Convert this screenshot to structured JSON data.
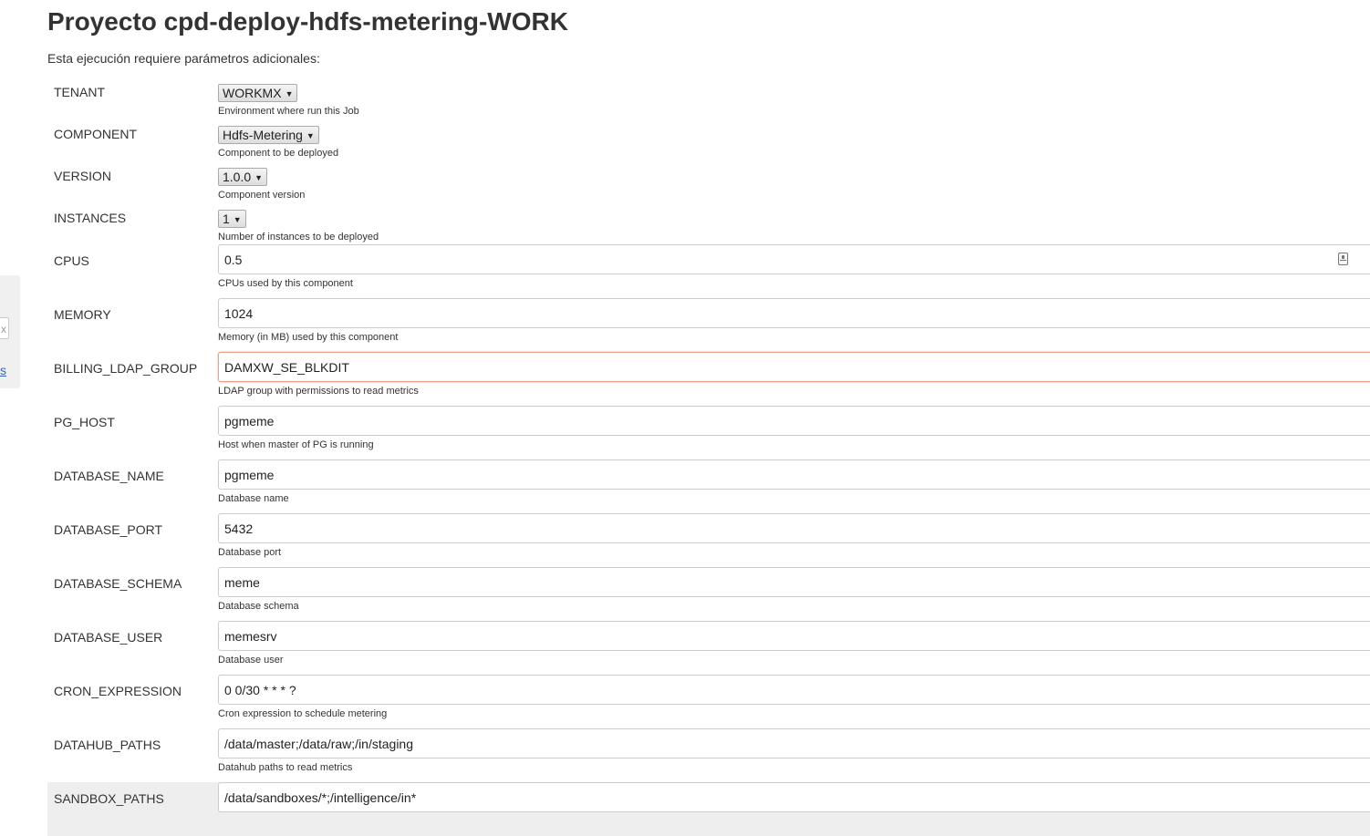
{
  "page": {
    "title": "Proyecto cpd-deploy-hdfs-metering-WORK",
    "intro": "Esta ejecución requiere parámetros adicionales:"
  },
  "sidebar": {
    "clear_label": "x",
    "link_label": "s"
  },
  "params": {
    "tenant": {
      "label": "TENANT",
      "value": "WORKMX",
      "help": "Environment where run this Job"
    },
    "component": {
      "label": "COMPONENT",
      "value": "Hdfs-Metering",
      "help": "Component to be deployed"
    },
    "version": {
      "label": "VERSION",
      "value": "1.0.0",
      "help": "Component version"
    },
    "instances": {
      "label": "INSTANCES",
      "value": "1",
      "help": "Number of instances to be deployed"
    },
    "cpus": {
      "label": "CPUS",
      "value": "0.5",
      "help": "CPUs used by this component",
      "icon": "password-manager-key-icon"
    },
    "memory": {
      "label": "MEMORY",
      "value": "1024",
      "help": "Memory (in MB) used by this component"
    },
    "billing_ldap_group": {
      "label": "BILLING_LDAP_GROUP",
      "value": "DAMXW_SE_BLKDIT",
      "help": "LDAP group with permissions to read metrics"
    },
    "pg_host": {
      "label": "PG_HOST",
      "value": "pgmeme",
      "help": "Host when master of PG is running"
    },
    "database_name": {
      "label": "DATABASE_NAME",
      "value": "pgmeme",
      "help": "Database name"
    },
    "database_port": {
      "label": "DATABASE_PORT",
      "value": "5432",
      "help": "Database port"
    },
    "database_schema": {
      "label": "DATABASE_SCHEMA",
      "value": "meme",
      "help": "Database schema"
    },
    "database_user": {
      "label": "DATABASE_USER",
      "value": "memesrv",
      "help": "Database user"
    },
    "cron_expression": {
      "label": "CRON_EXPRESSION",
      "value": "0 0/30 * * * ?",
      "help": "Cron expression to schedule metering"
    },
    "datahub_paths": {
      "label": "DATAHUB_PATHS",
      "value": "/data/master;/data/raw;/in/staging",
      "help": "Datahub paths to read metrics"
    },
    "sandbox_paths": {
      "label": "SANDBOX_PATHS",
      "value": "/data/sandboxes/*;/intelligence/in*"
    }
  },
  "colors": {
    "focus_border": "#e8a08c",
    "row_highlight": "#eeeeee",
    "link": "#3366bb"
  }
}
